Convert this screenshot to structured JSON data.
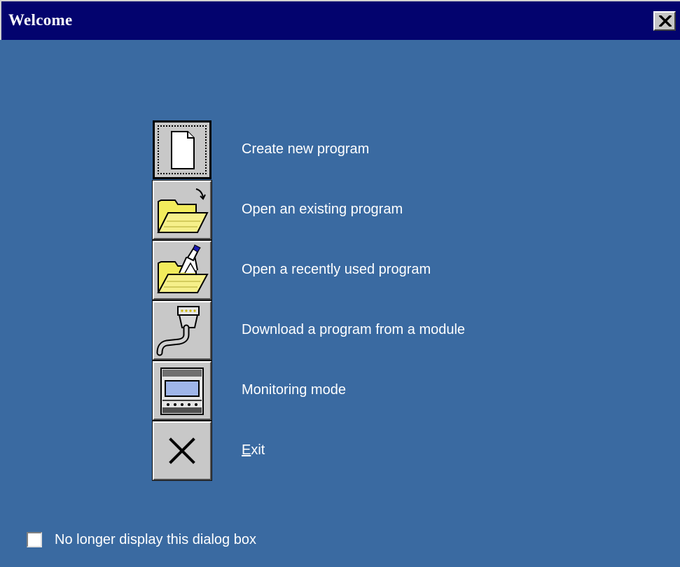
{
  "window": {
    "title": "Welcome",
    "close_symbol": "×"
  },
  "menu": {
    "items": [
      {
        "id": "create",
        "label": "Create new program",
        "icon": "new-document-icon"
      },
      {
        "id": "open",
        "label": "Open an existing program",
        "icon": "open-folder-icon"
      },
      {
        "id": "recent",
        "label": "Open a recently used program",
        "icon": "recent-folder-icon"
      },
      {
        "id": "download",
        "label": "Download a program from a module",
        "icon": "serial-cable-icon"
      },
      {
        "id": "monitor",
        "label": "Monitoring mode",
        "icon": "module-monitor-icon"
      },
      {
        "id": "exit",
        "label_mnemonic": "E",
        "label_rest": "xit",
        "icon": "exit-x-icon"
      }
    ]
  },
  "footer": {
    "checkbox_label": "No longer display this dialog box",
    "checkbox_checked": false
  },
  "colors": {
    "background": "#3a6aa1",
    "titlebar": "#03036e",
    "folder_yellow": "#f2ec5c",
    "button_face": "#c8c8c8"
  }
}
